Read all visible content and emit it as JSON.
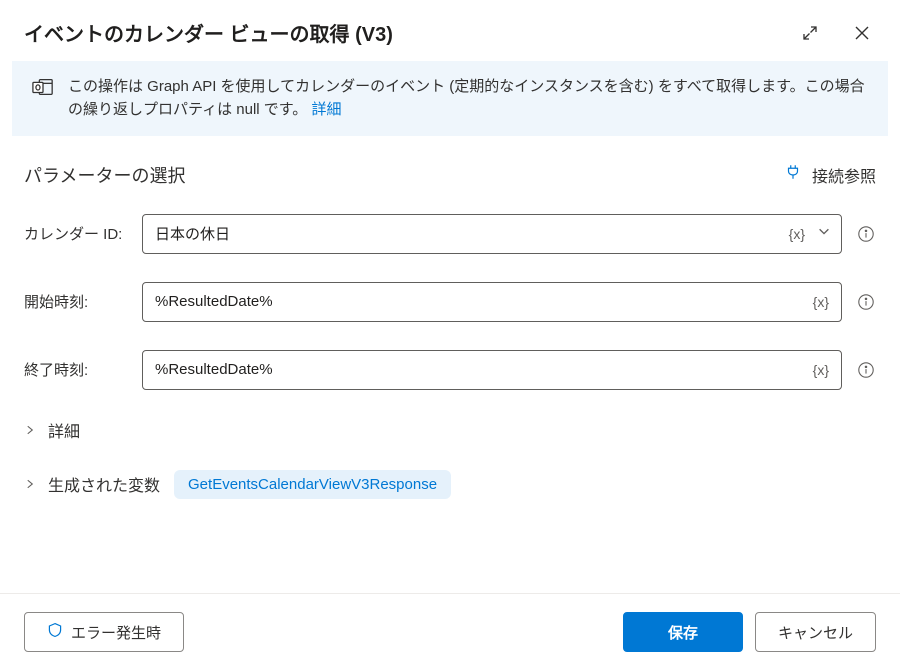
{
  "header": {
    "title": "イベントのカレンダー ビューの取得 (V3)"
  },
  "banner": {
    "text": "この操作は Graph API を使用してカレンダーのイベント (定期的なインスタンスを含む) をすべて取得します。この場合の繰り返しプロパティは null です。",
    "link_label": "詳細"
  },
  "section": {
    "heading": "パラメーターの選択",
    "connection_ref": "接続参照"
  },
  "fields": {
    "calendar_id": {
      "label": "カレンダー ID:",
      "value": "日本の休日",
      "token": "{x}"
    },
    "start_time": {
      "label": "開始時刻:",
      "value": "%ResultedDate%",
      "token": "{x}"
    },
    "end_time": {
      "label": "終了時刻:",
      "value": "%ResultedDate%",
      "token": "{x}"
    }
  },
  "expanders": {
    "advanced": "詳細",
    "generated_vars": "生成された変数",
    "var_name": "GetEventsCalendarViewV3Response"
  },
  "footer": {
    "on_error": "エラー発生時",
    "save": "保存",
    "cancel": "キャンセル"
  }
}
